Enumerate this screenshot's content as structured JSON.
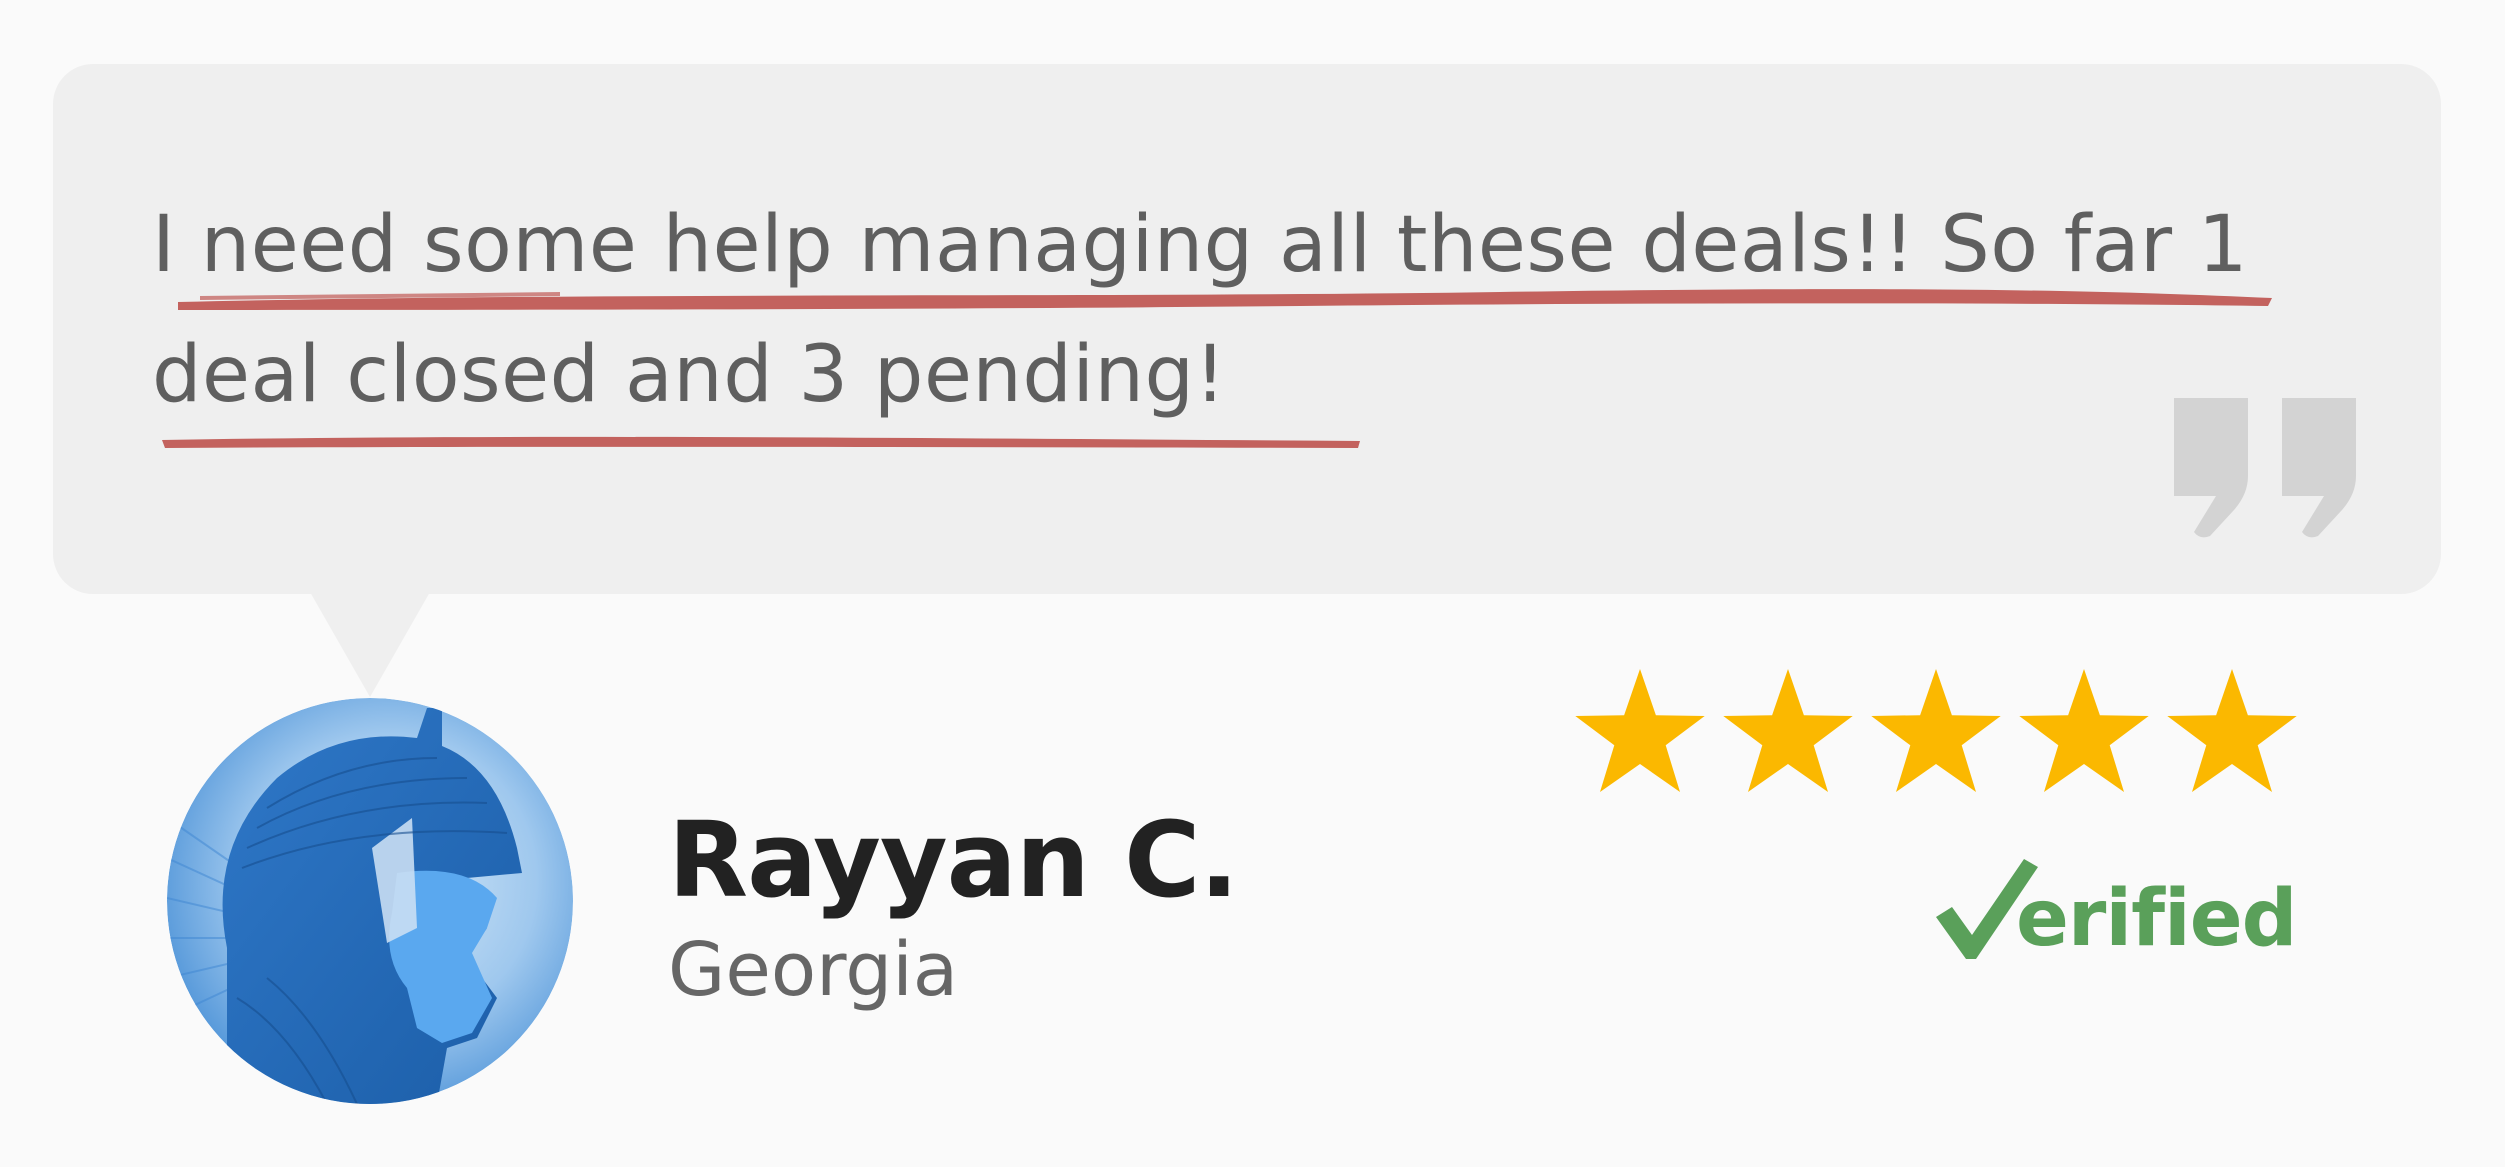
{
  "review": {
    "quote": "I need some help managing all these deals!! So far 1 deal closed and 3 pending!",
    "reviewer_name": "Rayyan C.",
    "reviewer_location": "Georgia",
    "rating": 5,
    "rating_max": 5,
    "verified_label": "erified"
  },
  "icons": {
    "quote_mark": "closing-quote-icon",
    "star": "star-icon",
    "verified_check": "check-icon",
    "avatar": "centurion-avatar"
  },
  "colors": {
    "bubble": "#efefef",
    "quote_text": "#5f5f5f",
    "underline": "#c05a55",
    "quote_mark": "#d3d3d3",
    "star": "#fbb800",
    "verified": "#5aa05a",
    "name": "#222222",
    "location": "#666666"
  }
}
